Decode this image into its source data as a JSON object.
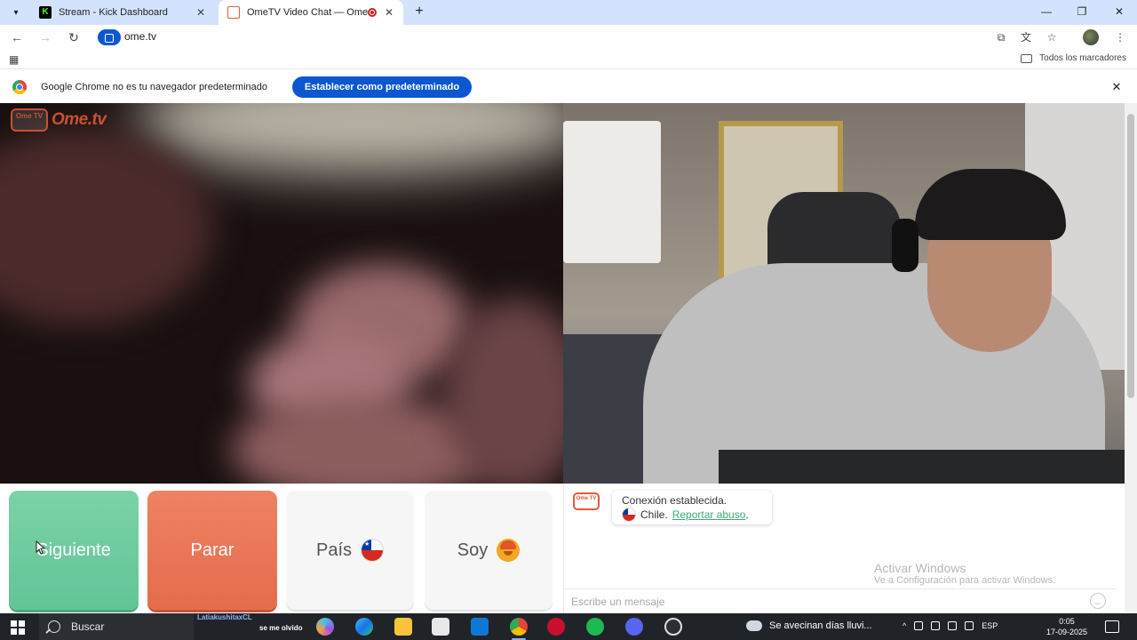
{
  "browser": {
    "tabs": [
      {
        "title": "Stream - Kick Dashboard",
        "favicon": "kick-icon",
        "active": false
      },
      {
        "title": "OmeTV Video Chat — Ome",
        "favicon": "ometv-icon",
        "active": true,
        "recording": true
      }
    ],
    "url": "ome.tv",
    "bookmarks_label": "Todos los marcadores"
  },
  "infobar": {
    "message": "Google Chrome no es tu navegador predeterminado",
    "button": "Establecer como predeterminado"
  },
  "ometv": {
    "logo_badge": "Ome TV",
    "logo_word": "Ome.tv",
    "controls": {
      "next": "Siguiente",
      "stop": "Parar",
      "country": "País",
      "gender": "Soy"
    },
    "chat": {
      "system_line1": "Conexión establecida.",
      "system_country": "Chile.",
      "report_link": "Reportar abuso",
      "report_suffix": ".",
      "input_placeholder": "Escribe un mensaje"
    }
  },
  "windows_watermark": {
    "line1": "Activar Windows",
    "line2": "Ve a Configuración para activar Windows."
  },
  "taskbar": {
    "search_placeholder": "Buscar",
    "news_line1": "LatiakushitaxCL",
    "news_line2": "se me olvido",
    "weather_text": "Se avecinan días lluvi...",
    "language": "ESP",
    "time": "0:05",
    "date": "17-09-2025"
  },
  "colors": {
    "next": "#62c496",
    "stop": "#e56c4d",
    "brand": "#e35b3b",
    "chrome_blue": "#0b57d0",
    "link": "#3aa979"
  }
}
